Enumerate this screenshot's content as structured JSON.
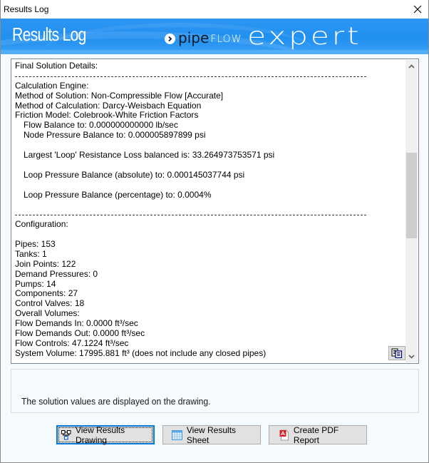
{
  "window": {
    "title": "Results Log",
    "close_icon": "close-icon"
  },
  "banner": {
    "heading": "Results Log",
    "brand": {
      "icon": "chevron-right-circle-icon",
      "part1": "pipe",
      "part2": "FLOW",
      "part3": "expert"
    },
    "colors": {
      "banner_blue": "#2190f0",
      "brand_dark": "#0e1a2b"
    }
  },
  "log": {
    "lines": [
      {
        "type": "text",
        "text": "Final Solution Details:"
      },
      {
        "type": "sep",
        "text": ""
      },
      {
        "type": "text",
        "text": "Calculation Engine:"
      },
      {
        "type": "text",
        "text": "Method of Solution: Non-Compressible Flow [Accurate]"
      },
      {
        "type": "text",
        "text": "Method of Calculation: Darcy-Weisbach Equation"
      },
      {
        "type": "text",
        "text": "Friction Model: Colebrook-White Friction Factors"
      },
      {
        "type": "indent",
        "text": "Flow Balance to: 0.000000000000 lb/sec"
      },
      {
        "type": "indent",
        "text": "Node Pressure Balance to: 0.000005897899 psi"
      },
      {
        "type": "text",
        "text": ""
      },
      {
        "type": "indent",
        "text": "Largest 'Loop' Resistance Loss balanced is: 33.264973753571 psi"
      },
      {
        "type": "text",
        "text": ""
      },
      {
        "type": "indent",
        "text": "Loop Pressure Balance (absolute) to: 0.000145037744 psi"
      },
      {
        "type": "text",
        "text": ""
      },
      {
        "type": "indent",
        "text": "Loop Pressure Balance (percentage) to: 0.0004%"
      },
      {
        "type": "text",
        "text": ""
      },
      {
        "type": "sep",
        "text": ""
      },
      {
        "type": "text",
        "text": "Configuration:"
      },
      {
        "type": "text",
        "text": ""
      },
      {
        "type": "text",
        "text": "Pipes: 153"
      },
      {
        "type": "text",
        "text": "Tanks: 1"
      },
      {
        "type": "text",
        "text": "Join Points: 122"
      },
      {
        "type": "text",
        "text": "Demand Pressures: 0"
      },
      {
        "type": "text",
        "text": "Pumps: 14"
      },
      {
        "type": "text",
        "text": "Components: 27"
      },
      {
        "type": "text",
        "text": "Control Valves: 18"
      },
      {
        "type": "text",
        "text": "Overall Volumes:"
      },
      {
        "type": "text",
        "text": "Flow Demands In: 0.0000 ft³/sec"
      },
      {
        "type": "text",
        "text": "Flow Demands Out: 0.0000 ft³/sec"
      },
      {
        "type": "text",
        "text": "Flow Controls: 47.1224 ft³/sec"
      },
      {
        "type": "text",
        "text": "System Volume: 17995.881 ft³ (does not include any closed pipes)"
      }
    ],
    "scroll_position": 0.42,
    "copy_button_icon": "copy-icon"
  },
  "status": {
    "message": "The solution values are displayed on the drawing."
  },
  "buttons": {
    "view_drawing": {
      "label": "View Results Drawing",
      "icon": "network-diagram-icon"
    },
    "view_sheet": {
      "label": "View Results Sheet",
      "icon": "spreadsheet-icon"
    },
    "create_pdf": {
      "label": "Create PDF Report",
      "icon": "pdf-file-icon"
    }
  },
  "colors": {
    "focus_border": "#0078d7",
    "button_face": "#e1e1e1",
    "dialog_bg": "#f5faff"
  }
}
